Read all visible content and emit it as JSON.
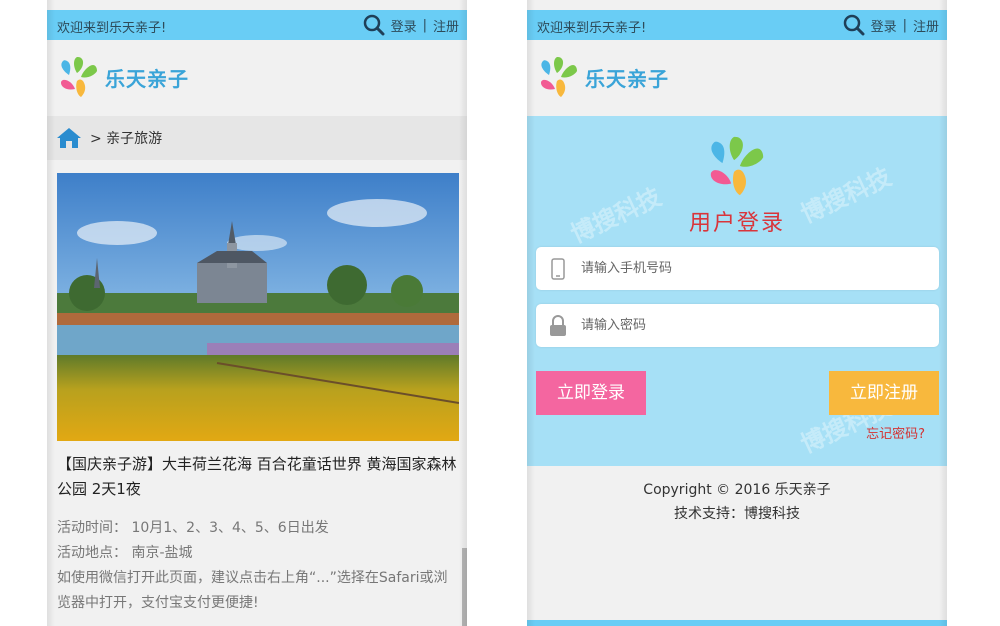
{
  "left": {
    "topbar": {
      "welcome": "欢迎来到乐天亲子!",
      "login": "登录",
      "sep": "|",
      "register": "注册"
    },
    "logo": {
      "name": "乐天亲子"
    },
    "breadcrumb": {
      "text": "> 亲子旅游"
    },
    "article": {
      "title": "【国庆亲子游】大丰荷兰花海 百合花童话世界 黄海国家森林公园 2天1夜",
      "info": [
        "活动时间： 10月1、2、3、4、5、6日出发",
        "活动地点： 南京-盐城",
        "如使用微信打开此页面，建议点击右上角“...”选择在Safari或浏览器中打开，支付宝支付更便捷!"
      ]
    }
  },
  "right": {
    "topbar": {
      "welcome": "欢迎来到乐天亲子!",
      "login": "登录",
      "sep": "|",
      "register": "注册"
    },
    "logo": {
      "name": "乐天亲子"
    },
    "login": {
      "title": "用户登录",
      "phone_placeholder": "请输入手机号码",
      "password_placeholder": "请输入密码",
      "login_button": "立即登录",
      "register_button": "立即注册",
      "forgot": "忘记密码?"
    },
    "footer": {
      "copyright": "Copyright © 2016 乐天亲子",
      "support": "技术支持：博搜科技"
    }
  },
  "watermark": {
    "text": "博搜科技"
  },
  "colors": {
    "topbar": "#69cdf5",
    "login_bg": "#a6e0f6",
    "login_btn": "#f466a0",
    "register_btn": "#f8b83d",
    "title_red": "#d9353b"
  },
  "icons": [
    "search-icon",
    "home-icon",
    "phone-icon",
    "lock-icon",
    "logo-mark"
  ]
}
